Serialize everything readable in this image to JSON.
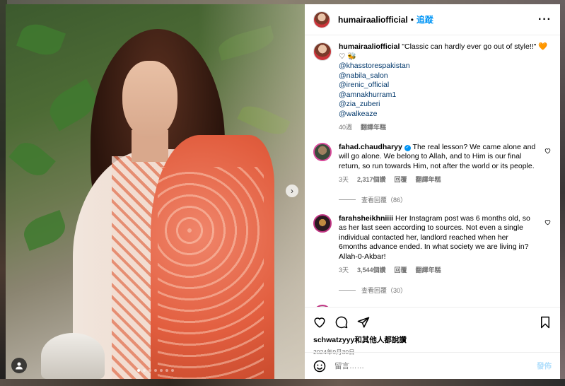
{
  "header": {
    "username": "humairaaliofficial",
    "separator": "•",
    "follow_label": "追蹤",
    "more_label": "···"
  },
  "caption": {
    "username": "humairaaliofficial",
    "text": "\"Classic can hardly ever go out of style!!\"",
    "emoji_heart": "🧡",
    "emoji_line2": "♡ 🐝",
    "mentions": [
      "@khasstorespakistan",
      "@nabila_salon",
      "@irenic_official",
      "@amnakhurram1",
      "@zia_zuberi",
      "@walkeaze"
    ],
    "age": "40週",
    "translate": "翻譯年糕"
  },
  "comments": [
    {
      "username": "fahad.chaudharyy",
      "verified": true,
      "text": "The real lesson? We came alone and will go alone. We belong to Allah, and to Him is our final return, so run towards Him, not after the world or its people.",
      "age": "3天",
      "likes": "2,317個讚",
      "reply": "回覆",
      "translate": "翻譯年糕",
      "view_replies": "查看回覆（86）"
    },
    {
      "username": "farahsheikhniiii",
      "verified": false,
      "text": "Her Instagram post was 6 months old, so as her last seen according to sources. Not even a single individual contacted her, landlord reached when her 6months advance ended. In what society we are living in? Allah-0-Akbar!",
      "age": "3天",
      "likes": "3,544個讚",
      "reply": "回覆",
      "translate": "翻譯年糕",
      "view_replies": "查看回覆（30）"
    }
  ],
  "footer": {
    "liked_by": "schwatzyyy和其他人都說讚",
    "date": "2024年9月30日",
    "comment_placeholder": "留言……",
    "post_label": "發佈"
  },
  "photo": {
    "next_arrow": "›",
    "carousel_count": 7,
    "carousel_active": 1
  },
  "icons": [
    "heart-icon",
    "comment-icon",
    "share-icon",
    "bookmark-icon",
    "emoji-icon",
    "user-tag-icon",
    "more-icon"
  ],
  "colors": {
    "link": "#00376b",
    "accent": "#0095f6",
    "secondary_text": "#737373"
  }
}
